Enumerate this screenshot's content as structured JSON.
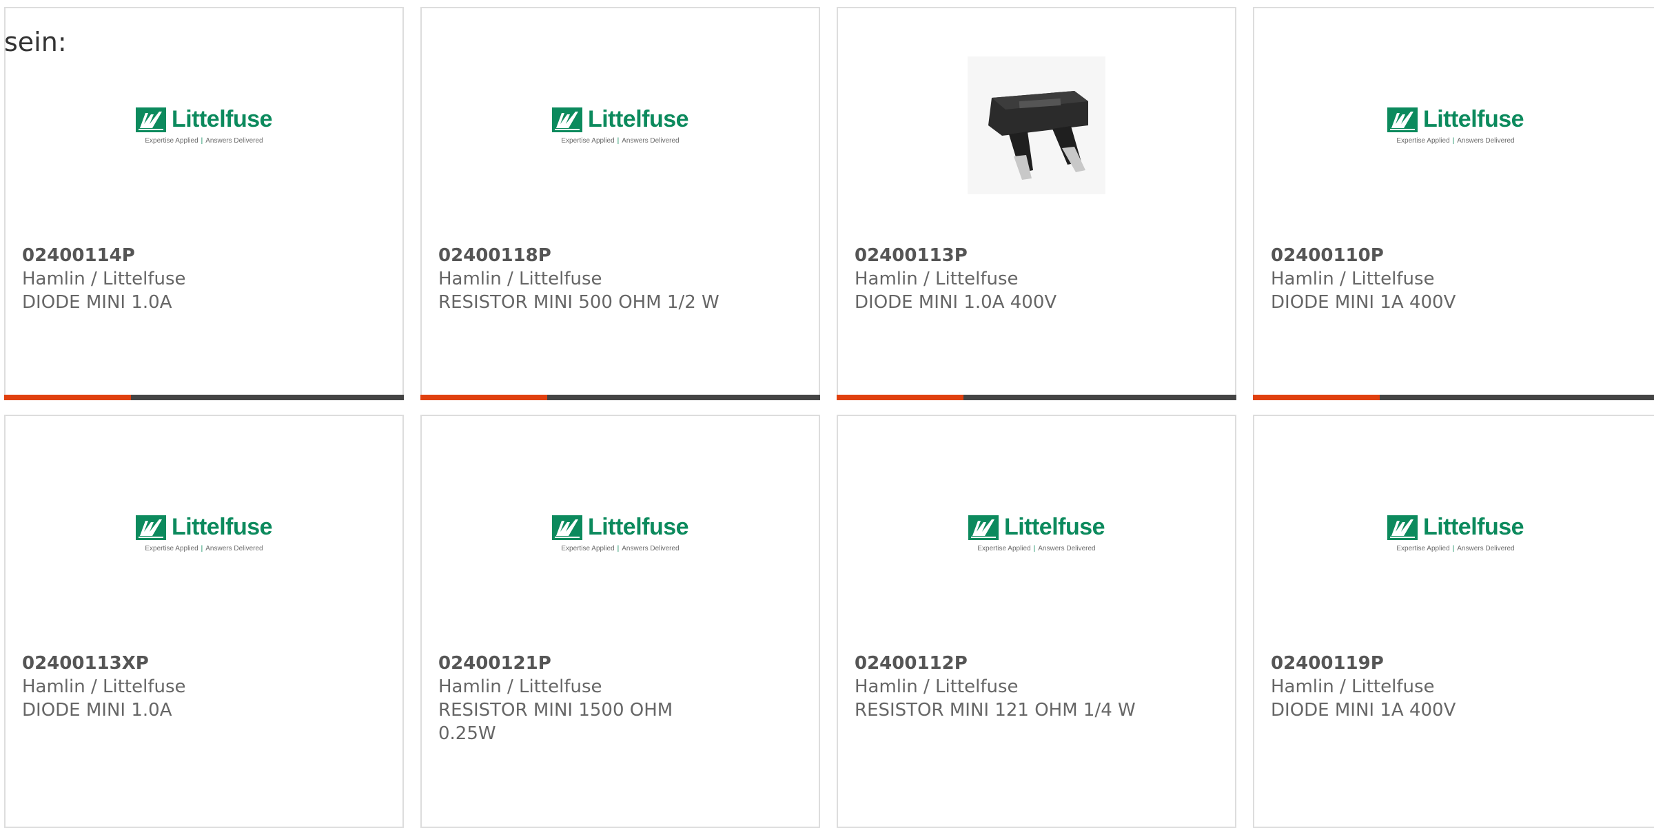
{
  "intro_text": "sein:",
  "logo": {
    "wordmark": "Littelfuse",
    "tagline_left": "Expertise Applied",
    "tagline_right": "Answers Delivered",
    "brand_color": "#0c8a5d"
  },
  "accent_color": "#e0400f",
  "products": [
    {
      "part": "02400114P",
      "maker": "Hamlin / Littelfuse",
      "desc": "DIODE MINI 1.0A",
      "image": "littelfuse-logo"
    },
    {
      "part": "02400118P",
      "maker": "Hamlin / Littelfuse",
      "desc": "RESISTOR MINI 500 OHM 1/2 W",
      "image": "littelfuse-logo"
    },
    {
      "part": "02400113P",
      "maker": "Hamlin / Littelfuse",
      "desc": "DIODE MINI 1.0A 400V",
      "image": "component-photo"
    },
    {
      "part": "02400110P",
      "maker": "Hamlin / Littelfuse",
      "desc": "DIODE MINI 1A 400V",
      "image": "littelfuse-logo"
    },
    {
      "part": "02400113XP",
      "maker": "Hamlin / Littelfuse",
      "desc": "DIODE MINI 1.0A",
      "image": "littelfuse-logo"
    },
    {
      "part": "02400121P",
      "maker": "Hamlin / Littelfuse",
      "desc": "RESISTOR MINI 1500 OHM 0.25W",
      "image": "littelfuse-logo"
    },
    {
      "part": "02400112P",
      "maker": "Hamlin / Littelfuse",
      "desc": "RESISTOR MINI 121 OHM 1/4 W",
      "image": "littelfuse-logo"
    },
    {
      "part": "02400119P",
      "maker": "Hamlin / Littelfuse",
      "desc": "DIODE MINI 1A 400V",
      "image": "littelfuse-logo"
    }
  ]
}
